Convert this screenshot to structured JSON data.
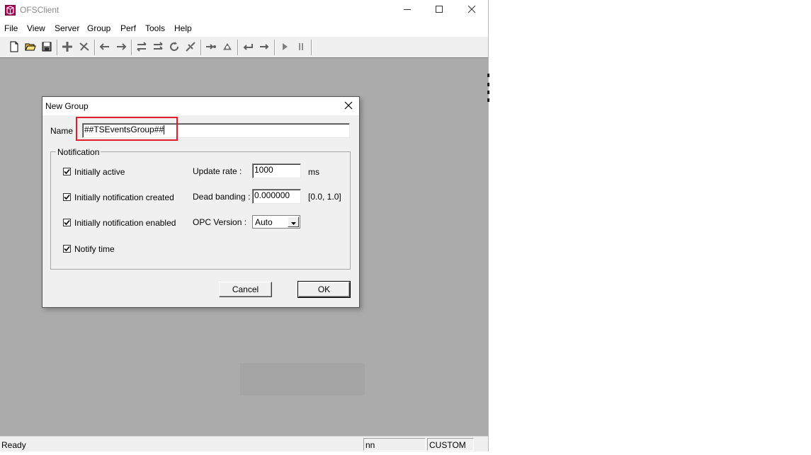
{
  "window": {
    "title": "OFSClient",
    "controls": [
      "minimize-icon",
      "maximize-icon",
      "close-icon"
    ]
  },
  "menu": [
    "File",
    "View",
    "Server",
    "Group",
    "Perf",
    "Tools",
    "Help"
  ],
  "toolbar": {
    "buttons": [
      "new-icon",
      "open-icon",
      "save-icon",
      "add-item-icon",
      "delete-icon",
      "back-icon",
      "forward-icon",
      "read-icon",
      "write-icon",
      "refresh-icon",
      "disconnect-icon",
      "async-icon",
      "callback-icon",
      "undo-icon",
      "redo-icon",
      "play-icon",
      "pause-icon"
    ]
  },
  "status": {
    "text": "Ready",
    "pane_partial": "nn",
    "pane_mode": "CUSTOM"
  },
  "dialog": {
    "title": "New Group",
    "name_label": "Name :",
    "name_value": "##TSEventsGroup##",
    "notification_legend": "Notification",
    "checkboxes": [
      {
        "label": "Initially active",
        "checked": true
      },
      {
        "label": "Initially notification created",
        "checked": true
      },
      {
        "label": "Initially notification enabled",
        "checked": true
      },
      {
        "label": "Notify time",
        "checked": true
      }
    ],
    "update_rate_label": "Update rate :",
    "update_rate_value": "1000",
    "update_rate_unit": "ms",
    "dead_banding_label": "Dead banding :",
    "dead_banding_value": "0.000000",
    "dead_banding_range": "[0.0, 1.0]",
    "opc_version_label": "OPC Version :",
    "opc_version_value": "Auto",
    "cancel_label": "Cancel",
    "ok_label": "OK"
  },
  "colors": {
    "highlight_border": "#e01e2a",
    "client_area": "#ababab",
    "chrome": "#f0f0f0"
  }
}
